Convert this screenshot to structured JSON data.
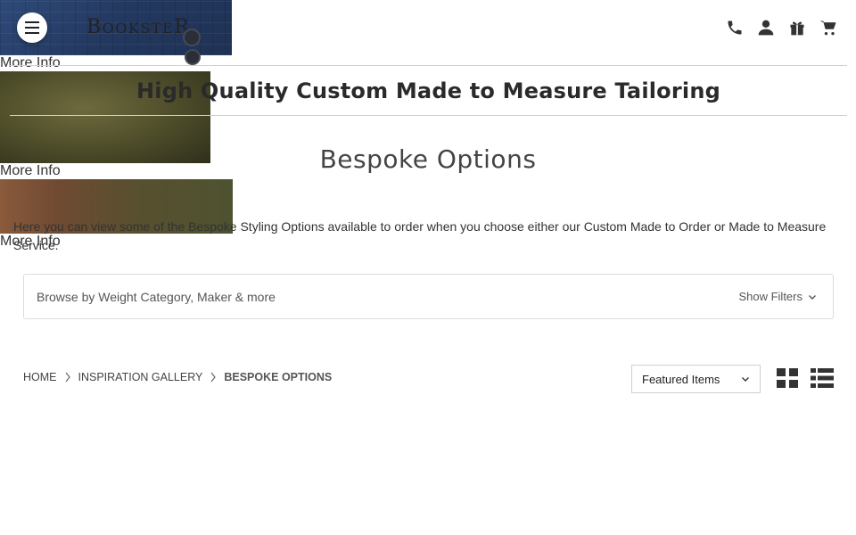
{
  "header": {
    "logo_text": "BOOKSTER",
    "icons": [
      "phone-icon",
      "user-icon",
      "gift-icon",
      "cart-icon"
    ]
  },
  "tagline": "High Quality Custom Made to Measure Tailoring",
  "page_title": "Bespoke Options",
  "intro_text": "Here you can view some of the Bespoke Styling Options available to order when you choose either our Custom Made to Order or Made to Measure Service.",
  "filters": {
    "label": "Browse by Weight Category, Maker & more",
    "toggle_label": "Show Filters"
  },
  "breadcrumb": [
    {
      "label": "HOME"
    },
    {
      "label": "INSPIRATION GALLERY"
    },
    {
      "label": "BESPOKE OPTIONS"
    }
  ],
  "sort": {
    "selected": "Featured Items"
  },
  "products": [
    {
      "more_label": "More Info"
    },
    {
      "more_label": "More Info"
    },
    {
      "more_label": "More Info"
    }
  ],
  "colors": {
    "text": "#333333",
    "border": "#cfcfcf"
  }
}
